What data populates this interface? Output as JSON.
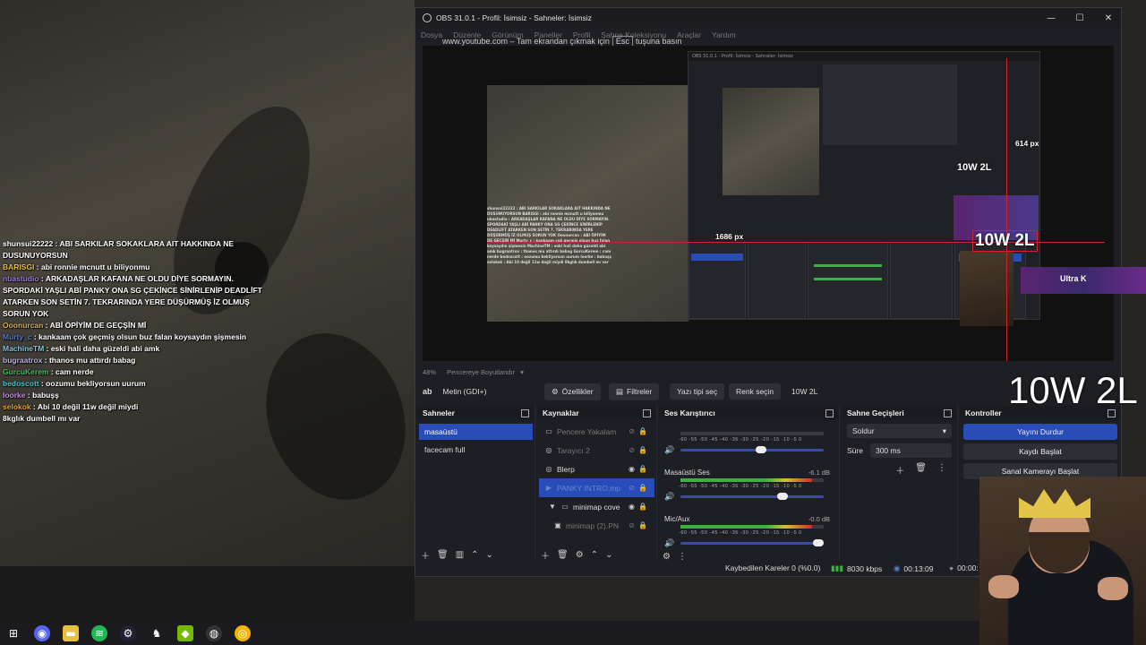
{
  "chat": [
    {
      "user": "shunsui22222",
      "color": "#ffffff",
      "text": " : ABI SARKILAR SOKAKLARA AIT HAKKINDA NE DUSUNUYORSUN"
    },
    {
      "user": "BARISGI",
      "color": "#e8c040",
      "text": " : abi ronnie mcnutt u biliyonmu"
    },
    {
      "user": "nbastudio",
      "color": "#9b7dd8",
      "text": " : ARKADAŞLAR KAFANA NE OLDU DİYE SORMAYIN. SPORDAKİ YAŞLI ABİ PANKY ONA SG ÇEKİNCE SİNİRLENİP DEADLİFT ATARKEN SON SETİN 7. TEKRARINDA YERE DÜŞÜRMÜŞ İZ OLMUŞ SORUN YOK"
    },
    {
      "user": "Ooonurcan",
      "color": "#d4b060",
      "text": " : ABİ ÖPİYİM DE GEÇŞİN Mİ"
    },
    {
      "user": "Murty_c",
      "color": "#5a7ac8",
      "text": " : kankaam çok geçmiş olsun buz falan koysaydın şişmesin"
    },
    {
      "user": "MachineTM",
      "color": "#7fc6e0",
      "text": " : eski hali daha güzeldi abi amk"
    },
    {
      "user": "bugraatrox",
      "color": "#c0b0e0",
      "text": " : thanos mu attırdı babag"
    },
    {
      "user": "GurcuKerem",
      "color": "#40c060",
      "text": " : cam nerde"
    },
    {
      "user": "bedoscott",
      "color": "#40c8c8",
      "text": " : oozumu bekliyorsun uurum"
    },
    {
      "user": "loorke",
      "color": "#c890e0",
      "text": " : babuşş"
    },
    {
      "user": "selokok",
      "color": "#e8a030",
      "text": " : Abi 10 değil 11w değil miydi"
    },
    {
      "user": "",
      "color": "#ffffff",
      "text": "8kglık dumbell mı var"
    }
  ],
  "window": {
    "title": "OBS 31.0.1 - Profil: İsimsiz - Sahneler: İsimsiz",
    "minimize": "—",
    "maximize": "☐",
    "close": "✕"
  },
  "menu": [
    "Dosya",
    "Düzenle",
    "Görünüm",
    "Paneller",
    "Profil",
    "Sahne Koleksiyonu",
    "Araçlar",
    "Yardım"
  ],
  "fullscreen_banner": {
    "pre": "www.youtube.com – Tam ekrandan çıkmak için",
    "key": "Esc",
    "post": "tuşuna basın"
  },
  "preview": {
    "zoom": "48%",
    "resize_label": "Pencereye Boyutlandır",
    "measure_614": "614 px",
    "measure_1686": "1686 px",
    "label_10w_small": "10W 2L",
    "label_10w_mid": "10W 2L",
    "ultra": "Ultra K",
    "mini_chat": "shunsui22222 : ABI SARKILAR SOKAKLARA AIT HAKKINDA NE DUSUNUYORSUN BARISGI : abi ronnie mcnutt u biliyonmu nbastudio : ARKADAŞLAR KAFANA NE OLDU DİYE SORMAYIN. SPORDAKİ YAŞLI ABİ PANKY ONA SG ÇEKİNCE SİNİRLENİP DEADLİFT ATARKEN SON SETİN 7. TEKRARINDA YERE DÜŞÜRMÜŞ İZ OLMUŞ SORUN YOK Ooonurcan : ABİ ÖPİYİM DE GEÇŞİN Mİ Murty_c : kankaam çok geçmiş olsun buz falan koysaydın şişmesin MachineTM : eski hali daha güzeldi abi amk bugraatrox : thanos mu attırdı babag GurcuKerem : cam nerde bedoscott : oozumu bekliyorsun uurum loorke : babuşş selokok : Abi 10 değil 11w değil miydi 8kglık dumbell mı var"
  },
  "toolbar": {
    "source_name": "Metin (GDI+)",
    "properties": "Özellikler",
    "filters": "Filtreler",
    "font_select": "Yazı tipi seç",
    "color_select": "Renk seçin",
    "text_value": "10W 2L"
  },
  "big_overlay_text": "10W 2L",
  "scenes": {
    "title": "Sahneler",
    "items": [
      "masaüstü",
      "facecam full"
    ]
  },
  "sources": {
    "title": "Kaynaklar",
    "items": [
      {
        "label": "Pencere Yakalam",
        "icon": "▭"
      },
      {
        "label": "Tarayıcı 2",
        "icon": "◎"
      },
      {
        "label": "Blerp",
        "icon": "◎"
      },
      {
        "label": "PANKY INTRO.mp",
        "icon": "▶"
      },
      {
        "label": "minimap cove",
        "icon": "▼"
      },
      {
        "label": "minimap (2).PN",
        "icon": "▣"
      }
    ]
  },
  "mixer": {
    "title": "Ses Karıştırıcı",
    "scale": "-60 -55 -50 -45 -40 -35 -30 -25 -20 -15 -10 -5 0",
    "channels": [
      {
        "name": "",
        "db": "",
        "volume": 0.6
      },
      {
        "name": "Masaüstü Ses",
        "db": "-6.1 dB",
        "volume": 0.75
      },
      {
        "name": "Mic/Aux",
        "db": "-0.0 dB",
        "volume": 1.0
      }
    ]
  },
  "transitions": {
    "title": "Sahne Geçişleri",
    "selected": "Soldur",
    "duration_label": "Süre",
    "duration_value": "300 ms"
  },
  "controls": {
    "title": "Kontroller",
    "stop_stream": "Yayını Durdur",
    "start_record": "Kaydı Başlat",
    "virtual_cam": "Sanal Kamerayı Başlat"
  },
  "status": {
    "dropped_frames": "Kaybedilen Kareler 0 (%0.0)",
    "bitrate": "8030 kbps",
    "stream_time": "00:13:09",
    "record_time": "00:00:"
  },
  "taskbar": [
    "windows-icon",
    "discord-icon",
    "explorer-icon",
    "spotify-icon",
    "steam-icon",
    "game-icon",
    "nvidia-icon",
    "obs-icon",
    "chrome-icon"
  ],
  "colors": {
    "accent": "#284cb8",
    "bg": "#1e1f24",
    "record_red": "#d0242a"
  }
}
